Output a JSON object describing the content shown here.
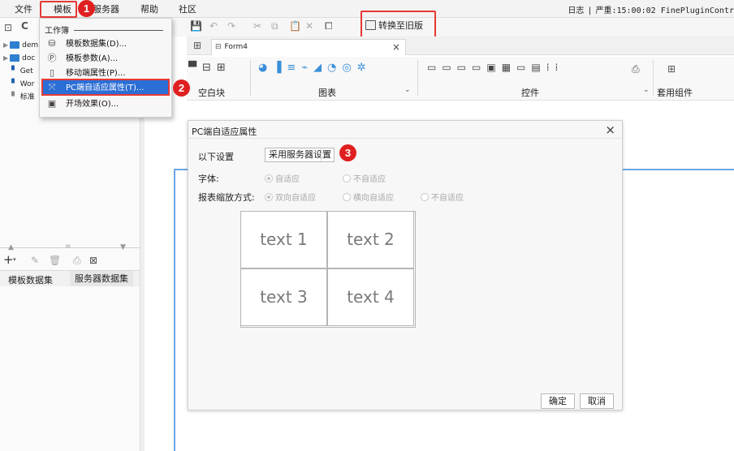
{
  "menubar": {
    "items": [
      "文件",
      "模板",
      "服务器",
      "帮助",
      "社区"
    ],
    "status": {
      "log": "日志",
      "severity": "严重",
      "time": "15:00:02",
      "plugin": "FinePluginContr"
    }
  },
  "badges": [
    "1",
    "2",
    "3"
  ],
  "left_panel": {
    "tree": [
      "dem",
      "doc",
      "Get",
      "Wor",
      "标准"
    ],
    "bottom_tabs": [
      "模板数据集",
      "服务器数据集"
    ]
  },
  "dropdown": {
    "header": "工作簿",
    "items": [
      "模板数据集(D)...",
      "模板参数(A)...",
      "移动端属性(P)...",
      "PC端自适应属性(T)...",
      "开场效果(O)..."
    ]
  },
  "toolbar": {
    "convert_label": "转换至旧版"
  },
  "doc_tab": {
    "name": "Form4",
    "close": "×"
  },
  "ribbon": {
    "groups": [
      "空白块",
      "图表",
      "控件",
      "套用组件"
    ]
  },
  "dialog": {
    "title": "PC端自适应属性",
    "close": "×",
    "setting_label": "以下设置",
    "setting_value": "采用服务器设置",
    "font_label": "字体:",
    "font_options": [
      "自适应",
      "不自适应"
    ],
    "scale_label": "报表缩放方式:",
    "scale_options": [
      "双向自适应",
      "横向自适应",
      "不自适应"
    ],
    "preview_cells": [
      "text 1",
      "text 2",
      "text 3",
      "text 4"
    ],
    "ok": "确定",
    "cancel": "取消"
  }
}
